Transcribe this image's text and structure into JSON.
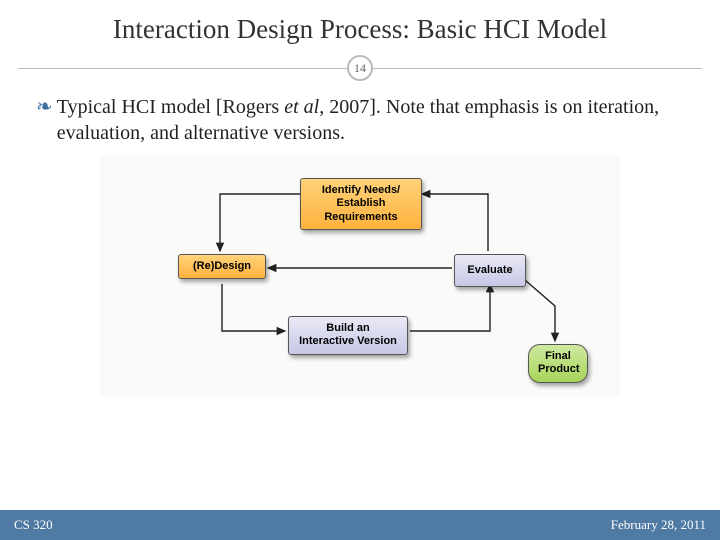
{
  "title": "Interaction Design Process: Basic HCI Model",
  "slide_number": "14",
  "bullet": {
    "glyph": "❧",
    "text_pre": "Typical HCI model [Rogers ",
    "text_italic": "et al",
    "text_post": ", 2007]. Note that emphasis is on iteration, evaluation, and alternative versions."
  },
  "diagram": {
    "nodes": {
      "identify": "Identify Needs/\nEstablish Requirements",
      "redesign": "(Re)Design",
      "evaluate": "Evaluate",
      "build": "Build an\nInteractive Version",
      "final": "Final\nProduct"
    }
  },
  "footer": {
    "left": "CS 320",
    "right": "February 28, 2011"
  },
  "colors": {
    "footer_bg": "#4f7aa3",
    "bullet_accent": "#3a6fa0"
  }
}
